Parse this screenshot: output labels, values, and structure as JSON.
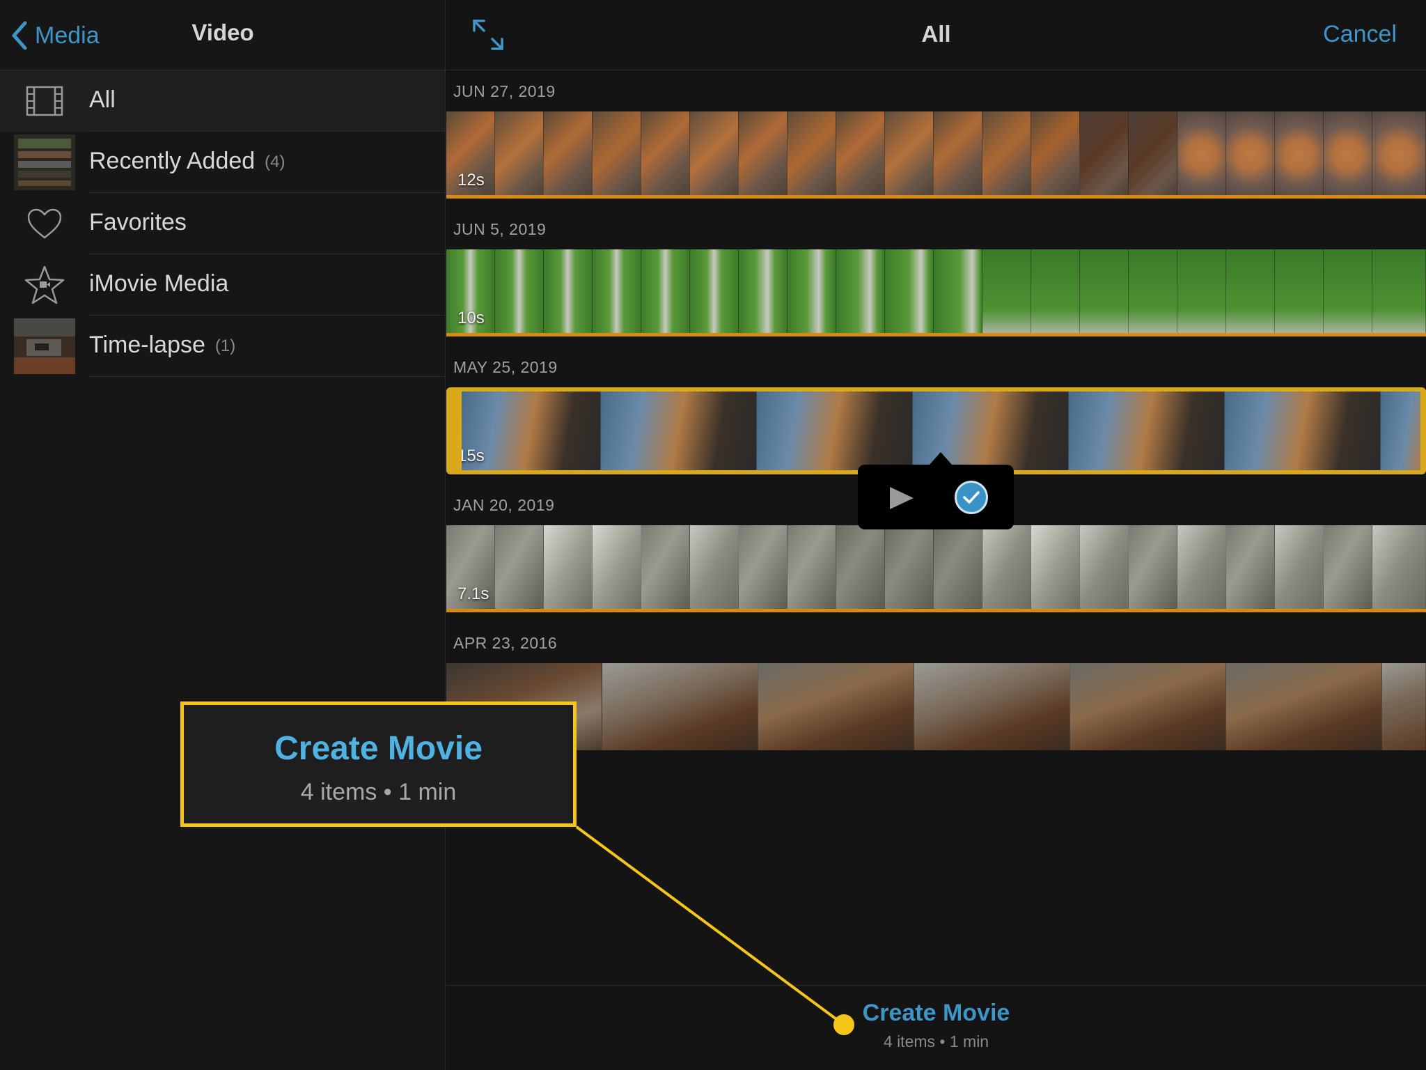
{
  "left": {
    "back_label": "Media",
    "title": "Video",
    "items": [
      {
        "label": "All",
        "count": "",
        "icon": "film-strip-icon"
      },
      {
        "label": "Recently Added",
        "count": "(4)",
        "icon": "recently-added-thumbnail"
      },
      {
        "label": "Favorites",
        "count": "",
        "icon": "heart-icon"
      },
      {
        "label": "iMovie Media",
        "count": "",
        "icon": "star-icon"
      },
      {
        "label": "Time-lapse",
        "count": "(1)",
        "icon": "time-lapse-thumbnail"
      }
    ]
  },
  "right": {
    "title": "All",
    "cancel_label": "Cancel",
    "groups": [
      {
        "date": "JUN 27, 2019",
        "duration": "12s"
      },
      {
        "date": "JUN 5, 2019",
        "duration": "10s"
      },
      {
        "date": "MAY 25, 2019",
        "duration": "15s"
      },
      {
        "date": "JAN 20, 2019",
        "duration": "7.1s"
      },
      {
        "date": "APR 23, 2016",
        "duration": ""
      }
    ]
  },
  "bottom": {
    "create_label": "Create Movie",
    "summary": "4 items • 1 min"
  },
  "callout": {
    "title": "Create Movie",
    "summary": "4 items • 1 min"
  },
  "colors": {
    "accent": "#3d95c8",
    "highlight": "#f5c518",
    "clip_bar": "#d98a10"
  }
}
